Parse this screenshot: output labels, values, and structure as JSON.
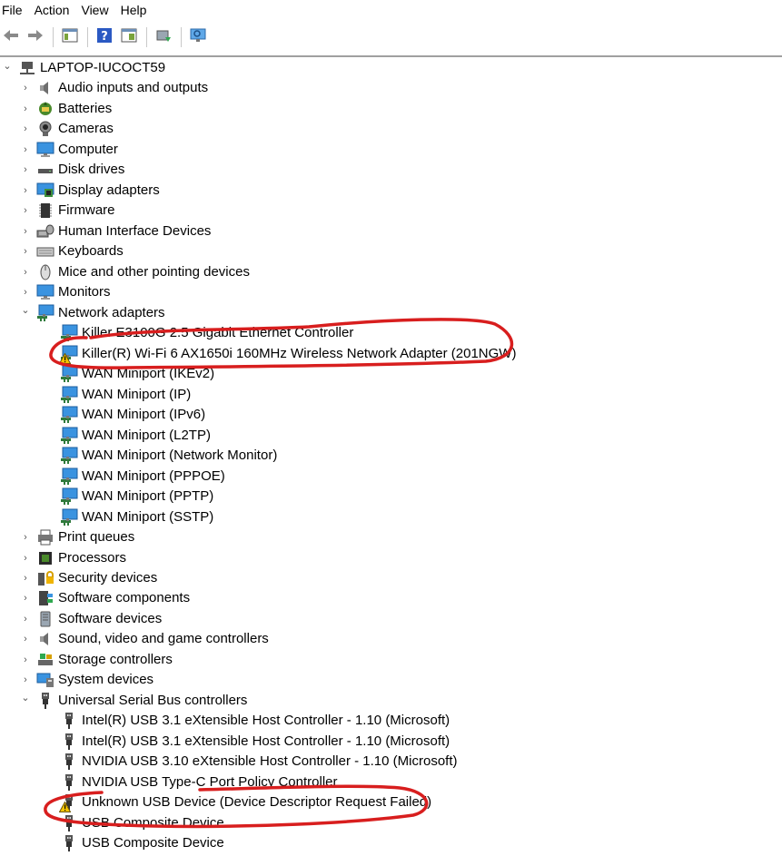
{
  "menu": [
    "File",
    "Action",
    "View",
    "Help"
  ],
  "toolbar": [
    "back-icon",
    "forward-icon",
    "show-hide-console-tree-icon",
    "help-icon",
    "properties-icon",
    "update-driver-icon",
    "scan-hardware-icon"
  ],
  "tree": {
    "root": "LAPTOP-IUCOCT59",
    "categories": [
      {
        "label": "Audio inputs and outputs",
        "icon": "speaker-icon",
        "expanded": false
      },
      {
        "label": "Batteries",
        "icon": "battery-icon",
        "expanded": false
      },
      {
        "label": "Cameras",
        "icon": "camera-icon",
        "expanded": false
      },
      {
        "label": "Computer",
        "icon": "monitor-icon",
        "expanded": false
      },
      {
        "label": "Disk drives",
        "icon": "disk-drive-icon",
        "expanded": false
      },
      {
        "label": "Display adapters",
        "icon": "display-adapter-icon",
        "expanded": false
      },
      {
        "label": "Firmware",
        "icon": "chip-icon",
        "expanded": false
      },
      {
        "label": "Human Interface Devices",
        "icon": "hid-icon",
        "expanded": false
      },
      {
        "label": "Keyboards",
        "icon": "keyboard-icon",
        "expanded": false
      },
      {
        "label": "Mice and other pointing devices",
        "icon": "mouse-icon",
        "expanded": false
      },
      {
        "label": "Monitors",
        "icon": "monitor-icon",
        "expanded": false
      },
      {
        "label": "Network adapters",
        "icon": "network-icon",
        "expanded": true,
        "children": [
          {
            "label": "Killer E3100G 2.5 Gigabit Ethernet Controller",
            "icon": "network-icon",
            "warning": false
          },
          {
            "label": "Killer(R) Wi-Fi 6 AX1650i 160MHz Wireless Network Adapter (201NGW)",
            "icon": "network-icon",
            "warning": true
          },
          {
            "label": "WAN Miniport (IKEv2)",
            "icon": "network-icon",
            "warning": false
          },
          {
            "label": "WAN Miniport (IP)",
            "icon": "network-icon",
            "warning": false
          },
          {
            "label": "WAN Miniport (IPv6)",
            "icon": "network-icon",
            "warning": false
          },
          {
            "label": "WAN Miniport (L2TP)",
            "icon": "network-icon",
            "warning": false
          },
          {
            "label": "WAN Miniport (Network Monitor)",
            "icon": "network-icon",
            "warning": false
          },
          {
            "label": "WAN Miniport (PPPOE)",
            "icon": "network-icon",
            "warning": false
          },
          {
            "label": "WAN Miniport (PPTP)",
            "icon": "network-icon",
            "warning": false
          },
          {
            "label": "WAN Miniport (SSTP)",
            "icon": "network-icon",
            "warning": false
          }
        ]
      },
      {
        "label": "Print queues",
        "icon": "printer-icon",
        "expanded": false
      },
      {
        "label": "Processors",
        "icon": "processor-icon",
        "expanded": false
      },
      {
        "label": "Security devices",
        "icon": "security-icon",
        "expanded": false
      },
      {
        "label": "Software components",
        "icon": "software-component-icon",
        "expanded": false
      },
      {
        "label": "Software devices",
        "icon": "software-device-icon",
        "expanded": false
      },
      {
        "label": "Sound, video and game controllers",
        "icon": "speaker-icon",
        "expanded": false
      },
      {
        "label": "Storage controllers",
        "icon": "storage-icon",
        "expanded": false
      },
      {
        "label": "System devices",
        "icon": "system-icon",
        "expanded": false
      },
      {
        "label": "Universal Serial Bus controllers",
        "icon": "usb-icon",
        "expanded": true,
        "children": [
          {
            "label": "Intel(R) USB 3.1 eXtensible Host Controller - 1.10 (Microsoft)",
            "icon": "usb-icon",
            "warning": false
          },
          {
            "label": "Intel(R) USB 3.1 eXtensible Host Controller - 1.10 (Microsoft)",
            "icon": "usb-icon",
            "warning": false
          },
          {
            "label": "NVIDIA USB 3.10 eXtensible Host Controller - 1.10 (Microsoft)",
            "icon": "usb-icon",
            "warning": false
          },
          {
            "label": "NVIDIA USB Type-C Port Policy Controller",
            "icon": "usb-icon",
            "warning": false
          },
          {
            "label": "Unknown USB Device (Device Descriptor Request Failed)",
            "icon": "usb-icon",
            "warning": true
          },
          {
            "label": "USB Composite Device",
            "icon": "usb-icon",
            "warning": false
          },
          {
            "label": "USB Composite Device",
            "icon": "usb-icon",
            "warning": false
          }
        ]
      }
    ]
  },
  "colors": {
    "annotation": "#d81e1e",
    "warning": "#f5c400",
    "accent": "#2d7fd6"
  }
}
